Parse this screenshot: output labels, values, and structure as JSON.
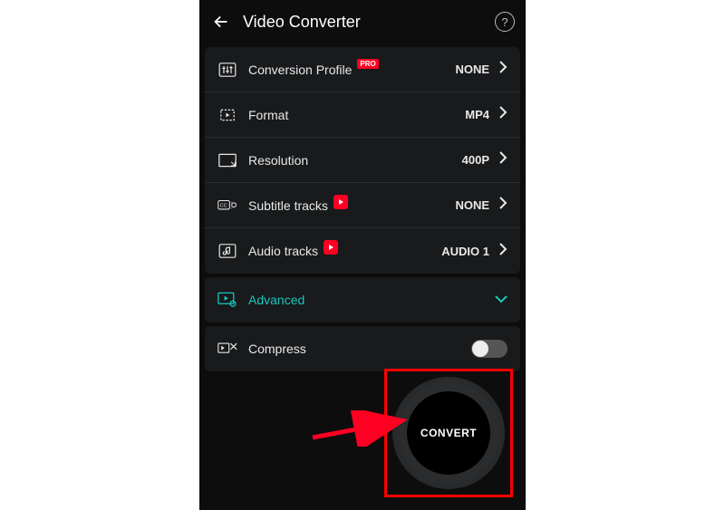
{
  "header": {
    "title": "Video Converter"
  },
  "settings": [
    {
      "id": "profile",
      "label": "Conversion Profile",
      "badge": "PRO",
      "value": "NONE"
    },
    {
      "id": "format",
      "label": "Format",
      "value": "MP4"
    },
    {
      "id": "resolution",
      "label": "Resolution",
      "value": "400P"
    },
    {
      "id": "subtitle",
      "label": "Subtitle tracks",
      "rec": true,
      "value": "NONE"
    },
    {
      "id": "audio",
      "label": "Audio tracks",
      "rec": true,
      "value": "AUDIO 1"
    }
  ],
  "advanced": {
    "label": "Advanced"
  },
  "compress": {
    "label": "Compress",
    "state": "off"
  },
  "convert": {
    "label": "CONVERT"
  }
}
